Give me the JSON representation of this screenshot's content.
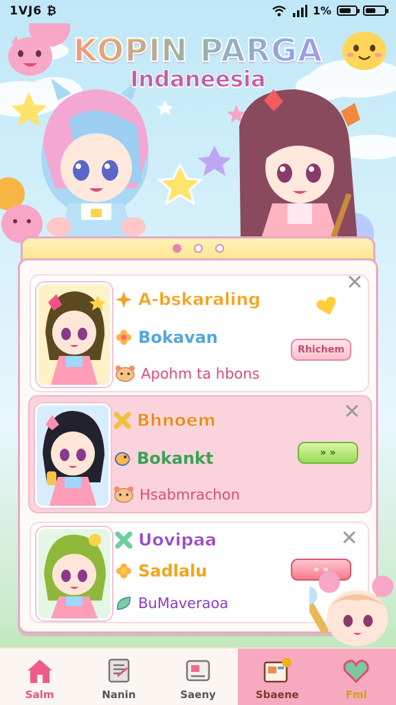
{
  "status_bar": {
    "time": "1VJ6 ₿",
    "battery_text": "1%"
  },
  "header": {
    "title": "KOPIN PARGA",
    "subtitle": "Indaneesia"
  },
  "pager": {
    "dots": 3,
    "active_index": 0
  },
  "cards": [
    {
      "title": "A-bskaraling",
      "title_color": "#f4a21c",
      "subtitle": "Bokavan",
      "subtitle_color": "#55a7d8",
      "description": "Apohm ta hbons",
      "description_color": "#d8506f",
      "button_label": "Rhichem",
      "button_style": "pink",
      "icons": [
        "sparkle-icon",
        "hamster-icon"
      ]
    },
    {
      "title": "Bhnoem",
      "title_color": "#f08a1c",
      "subtitle": "Bokankt",
      "subtitle_color": "#3aa256",
      "description": "Hsabmrachon",
      "description_color": "#d8506f",
      "button_label": "» »",
      "button_style": "green",
      "icons": [
        "x-star-icon",
        "bird-icon",
        "hamster-icon"
      ]
    },
    {
      "title": "Uovipaa",
      "title_color": "#9a49c8",
      "subtitle": "Sadlalu",
      "subtitle_color": "#f0a51c",
      "description": "BuMaveraoa",
      "description_color": "#8a3fc0",
      "button_label": "» »",
      "button_style": "red",
      "icons": [
        "x-star-icon",
        "flower-icon",
        "leaf-icon"
      ]
    }
  ],
  "bottom_nav": [
    {
      "label": "Salm",
      "icon": "home-icon",
      "active": true
    },
    {
      "label": "Nanin",
      "icon": "book-icon",
      "active": false
    },
    {
      "label": "Saeny",
      "icon": "card-icon",
      "active": false
    },
    {
      "label": "Sbaene",
      "icon": "shop-icon",
      "active": false
    },
    {
      "label": "Fml",
      "icon": "heart-icon",
      "active": false
    }
  ]
}
